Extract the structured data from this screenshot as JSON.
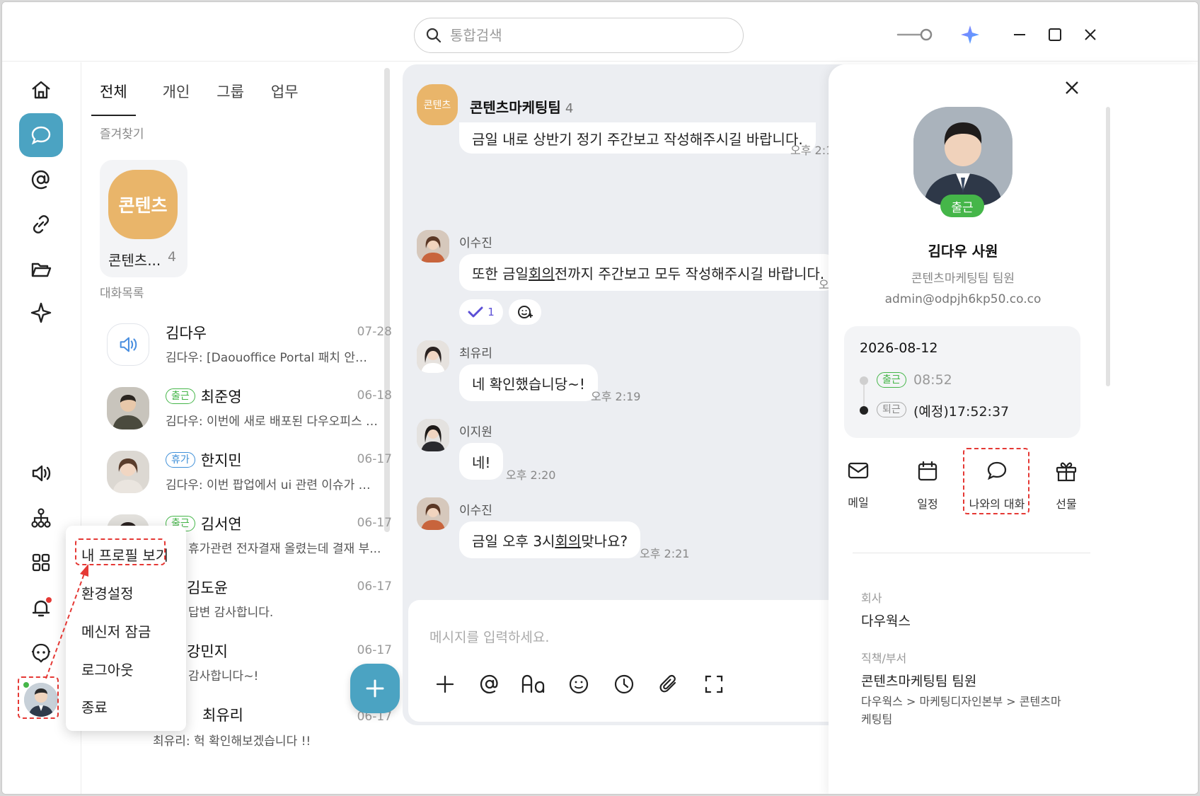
{
  "search": {
    "placeholder": "통합검색"
  },
  "list": {
    "tabs": [
      "전체",
      "개인",
      "그룹",
      "업무"
    ],
    "favorites_label": "즐겨찾기",
    "favorite": {
      "badge": "콘텐츠",
      "name": "콘텐츠...",
      "count": "4"
    },
    "conversations_label": "대화목록",
    "rows": [
      {
        "name": "김다우",
        "badge": "",
        "date": "07-28",
        "preview": "김다우: [Daouoffice Portal 패치 안내] 안녕..."
      },
      {
        "name": "최준영",
        "badge": "출근",
        "date": "06-18",
        "preview": "김다우: 이번에 새로 배포된 다우오피스 기능 ..."
      },
      {
        "name": "한지민",
        "badge": "휴가",
        "date": "06-17",
        "preview": "김다우: 이번 팝업에서 ui 관련 이슈가 있어 공..."
      },
      {
        "name": "김서연",
        "badge": "출근",
        "date": "06-17",
        "preview": "휴가관련 전자결재 올렸는데 결재 부..."
      },
      {
        "name": "김도윤",
        "badge": "",
        "date": "06-17",
        "preview": "답변 감사합니다."
      },
      {
        "name": "강민지",
        "badge": "",
        "date": "06-17",
        "preview": "감사합니다~!"
      },
      {
        "name": "최유리",
        "badge": "",
        "date": "06-17",
        "preview": "최유리: 헉 확인해보겠습니다 !!"
      }
    ]
  },
  "menu": {
    "items": [
      "내 프로필 보기",
      "환경설정",
      "메신저 잠금",
      "로그아웃",
      "종료"
    ]
  },
  "chat": {
    "badge": "콘텐츠",
    "title": "콘텐츠마케팅팀",
    "member_count": "4",
    "messages": [
      {
        "text": "금일 내로 상반기 정기 주간보고 작성해주시길 바랍니다.",
        "time": "오후 2:1"
      },
      {
        "sender": "이수진",
        "text_pre": "또한 금일 ",
        "text_link": "회의",
        "text_post": " 전까지 주간보고 모두 작성해주시길 바랍니다.",
        "time": "오"
      },
      {
        "reaction_count": "1"
      },
      {
        "sender": "최유리",
        "text": "네 확인했습니당~!",
        "time": "오후 2:19"
      },
      {
        "sender": "이지원",
        "text": "네!",
        "time": "오후 2:20"
      },
      {
        "sender": "이수진",
        "text_pre": "금일 오후 3시 ",
        "text_link": "회의",
        "text_post": " 맞나요?",
        "time": "오후 2:21"
      }
    ],
    "composer_placeholder": "메시지를 입력하세요."
  },
  "profile": {
    "status": "출근",
    "name": "김다우 사원",
    "team": "콘텐츠마케팅팀 팀원",
    "email": "admin@odpjh6kp50.co.co",
    "attendance": {
      "date": "2026-08-12",
      "in_label": "출근",
      "in_time": "08:52",
      "out_label": "퇴근",
      "out_time": "(예정)17:52:37"
    },
    "actions": [
      "메일",
      "일정",
      "나와의 대화",
      "선물"
    ],
    "company_label": "회사",
    "company": "다우웍스",
    "position_label": "직책/부서",
    "position": "콘텐츠마케팅팀 팀원",
    "dept_path": "다우웍스 > 마케팅디자인본부 > 콘텐츠마케팅팀"
  },
  "colors": {
    "accent": "#4ba3c2",
    "favorite": "#e9b56a",
    "online": "#45b649",
    "highlight": "#e53935"
  }
}
